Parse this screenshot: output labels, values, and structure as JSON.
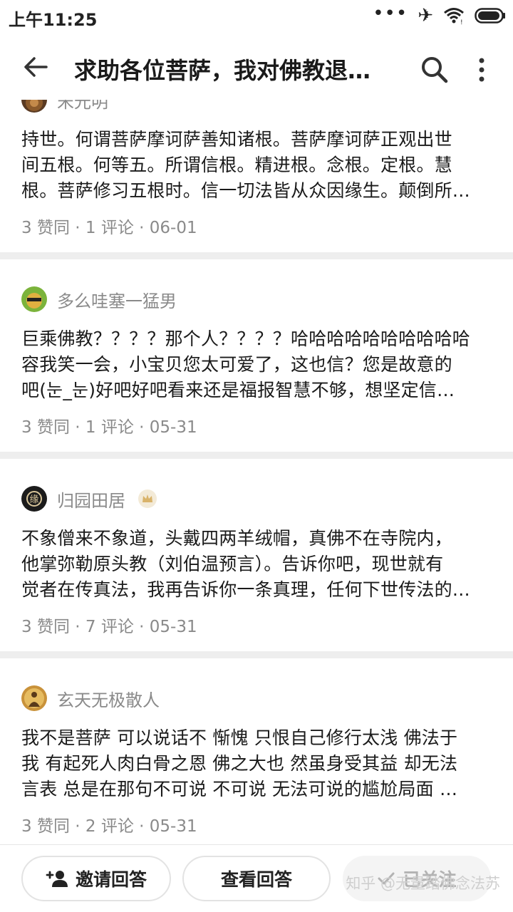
{
  "status_bar": {
    "time": "上午11:25",
    "dots": "•••",
    "airplane": "✈"
  },
  "header": {
    "title": "求助各位菩萨，我对佛教退…"
  },
  "answers": [
    {
      "author": "宋光明",
      "lines": [
        "持世。何谓菩萨摩诃萨善知诸根。菩萨摩诃萨正观出世",
        "间五根。何等五。所谓信根。精进根。念根。定根。慧",
        "根。菩萨修习五根时。信一切法皆从众因缘生。颠倒所…"
      ],
      "meta": "3 赞同 · 1 评论 · 06-01"
    },
    {
      "author": "多么哇塞一猛男",
      "lines": [
        "巨乘佛教？？？？那个人？？？？哈哈哈哈哈哈哈哈哈哈",
        "容我笑一会，小宝贝您太可爱了，这也信？您是故意的",
        "吧(눈_눈)好吧好吧看来还是福报智慧不够，想坚定信…"
      ],
      "meta": "3 赞同 · 1 评论 · 05-31"
    },
    {
      "author": "归园田居",
      "lines": [
        "不象僧来不象道，头戴四两羊绒帽，真佛不在寺院内，",
        "他掌弥勒原头教（刘伯温预言）。告诉你吧，现世就有",
        "觉者在传真法，我再告诉你一条真理，任何下世传法的…"
      ],
      "meta": "3 赞同 · 7 评论 · 05-31"
    },
    {
      "author": "玄天无极散人",
      "lines": [
        "我不是菩萨 可以说话不 惭愧 只恨自己修行太浅 佛法于",
        "我 有起死人肉白骨之恩 佛之大也 然虽身受其益 却无法",
        "言表 总是在那句不可说 不可说 无法可说的尴尬局面 …"
      ],
      "meta": "3 赞同 · 2 评论 · 05-31"
    }
  ],
  "bottom_bar": {
    "invite_label": "邀请回答",
    "view_label": "查看回答",
    "followed_label": "已关注",
    "watermark": "知乎 @无量踏佛念法苏"
  },
  "colors": {
    "text_primary": "#1a1a1a",
    "text_secondary": "#8a8a8a",
    "divider": "#eeeeee",
    "badge_gold": "#d9b36a"
  }
}
